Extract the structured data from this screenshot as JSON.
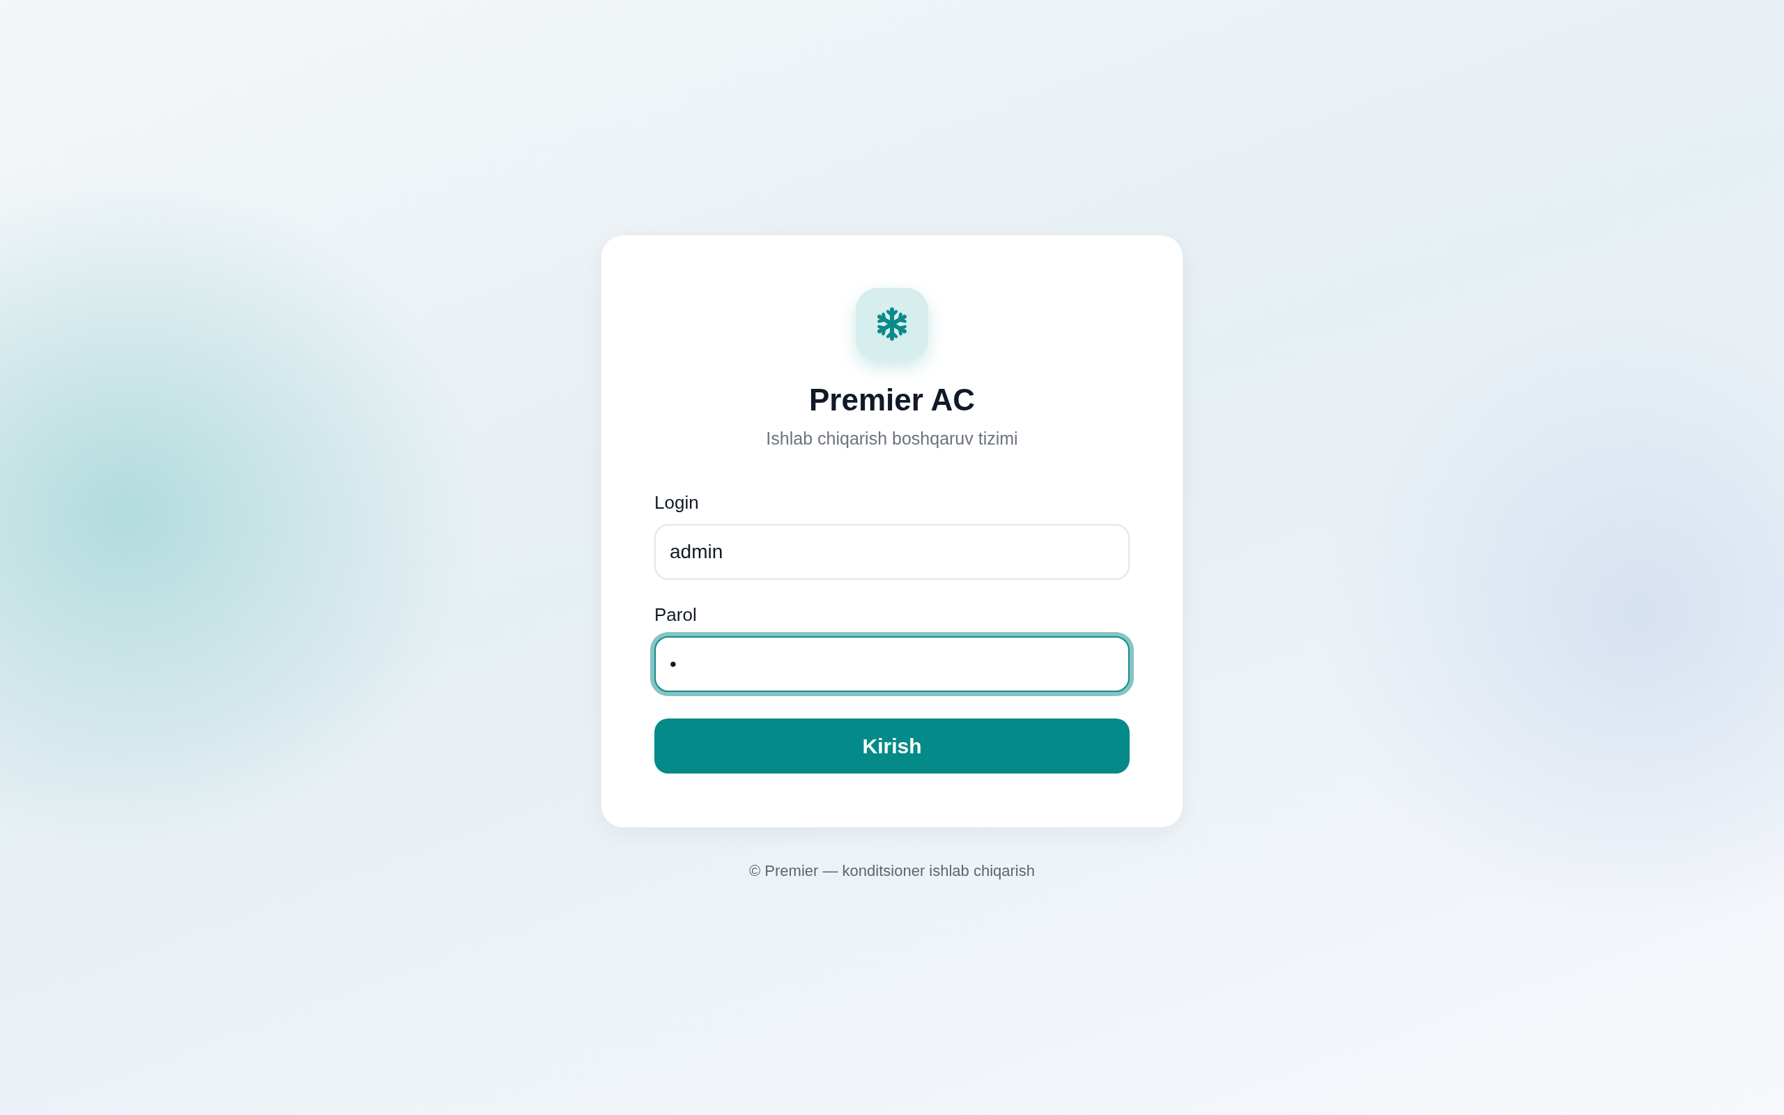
{
  "brand": {
    "title": "Premier AC",
    "subtitle": "Ishlab chiqarish boshqaruv tizimi"
  },
  "fields": [
    {
      "label": "Login",
      "value": "admin",
      "focused": false
    },
    {
      "label": "Parol",
      "value": "•",
      "focused": true
    }
  ],
  "submit_button": {
    "label": "Kirish"
  },
  "footer": "© Premier — konditsioner ishlab chiqarish"
}
